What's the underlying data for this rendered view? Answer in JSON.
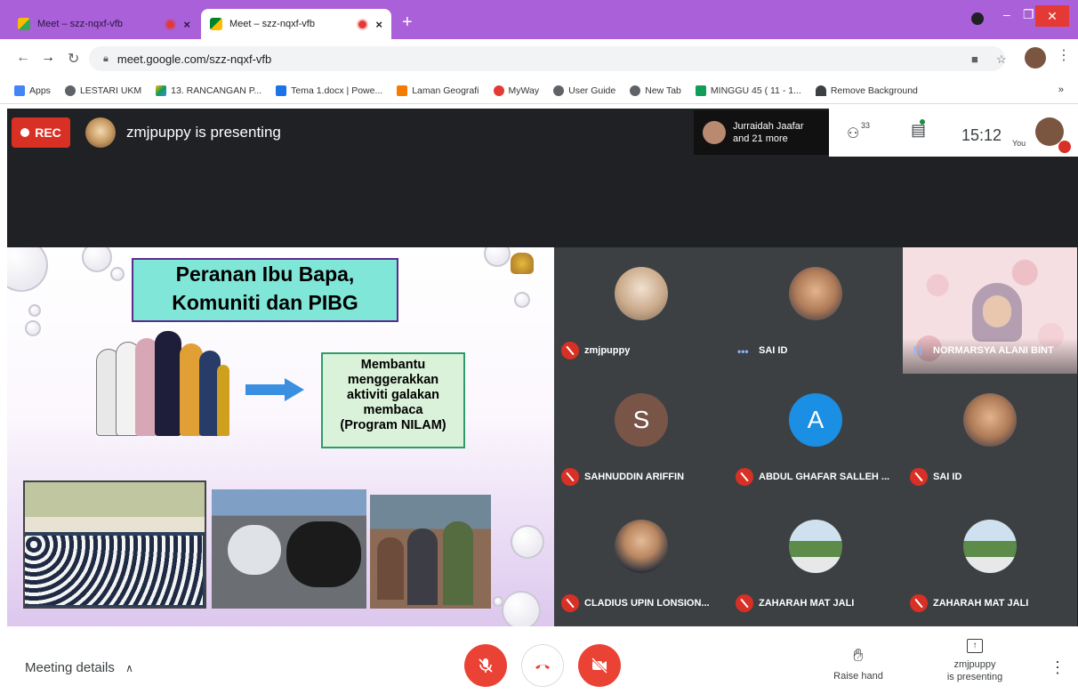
{
  "browser": {
    "tabs": [
      {
        "title": "Meet – szz-nqxf-vfb",
        "close": "×"
      },
      {
        "title": "Meet – szz-nqxf-vfb",
        "close": "×"
      }
    ],
    "new_tab": "+",
    "address": "meet.google.com/szz-nqxf-vfb",
    "bookmarks": [
      {
        "label": "Apps",
        "color": "#4285f4"
      },
      {
        "label": "LESTARI UKM",
        "color": "#5f6368"
      },
      {
        "label": "13. RANCANGAN P...",
        "color": "#fbbc04"
      },
      {
        "label": "Tema 1.docx | Powe...",
        "color": "#1a73e8"
      },
      {
        "label": "Laman Geografi",
        "color": "#f57c00"
      },
      {
        "label": "MyWay",
        "color": "#e53935"
      },
      {
        "label": "User Guide",
        "color": "#5f6368"
      },
      {
        "label": "New Tab",
        "color": "#5f6368"
      },
      {
        "label": "MINGGU 45 ( 11 - 1...",
        "color": "#0f9d58"
      },
      {
        "label": "Remove Background",
        "color": "#3c4043"
      }
    ],
    "bookmarks_more": "»"
  },
  "meet": {
    "rec_label": "REC",
    "presenting_text": "zmjpuppy is presenting",
    "active_speaker": {
      "line1": "Jurraidah Jaafar",
      "line2": "and 21 more"
    },
    "participant_count": "33",
    "time": "15:12",
    "you_label": "You",
    "slide": {
      "title_line1": "Peranan Ibu Bapa,",
      "title_line2": "Komuniti dan PIBG",
      "box_lines": [
        "Membantu",
        "menggerakkan",
        "aktiviti galakan",
        "membaca",
        "(Program NILAM)"
      ]
    },
    "participants": [
      {
        "name": "zmjpuppy",
        "status": "muted"
      },
      {
        "name": "SAI ID",
        "status": "speaking"
      },
      {
        "name": "NORMARSYA ALANI BINT",
        "status": "speaking"
      },
      {
        "name": "SAHNUDDIN ARIFFIN",
        "status": "muted",
        "initial": "S",
        "color": "#795548"
      },
      {
        "name": "ABDUL GHAFAR SALLEH ...",
        "status": "muted",
        "initial": "A",
        "color": "#1a8fe3"
      },
      {
        "name": "SAI ID",
        "status": "muted"
      },
      {
        "name": "CLADIUS UPIN LONSION...",
        "status": "muted"
      },
      {
        "name": "ZAHARAH MAT JALI",
        "status": "muted"
      },
      {
        "name": "ZAHARAH MAT JALI",
        "status": "muted"
      }
    ],
    "bottom": {
      "meeting_details": "Meeting details",
      "raise_hand": "Raise hand",
      "presenting_line1": "zmjpuppy",
      "presenting_line2": "is presenting"
    }
  }
}
